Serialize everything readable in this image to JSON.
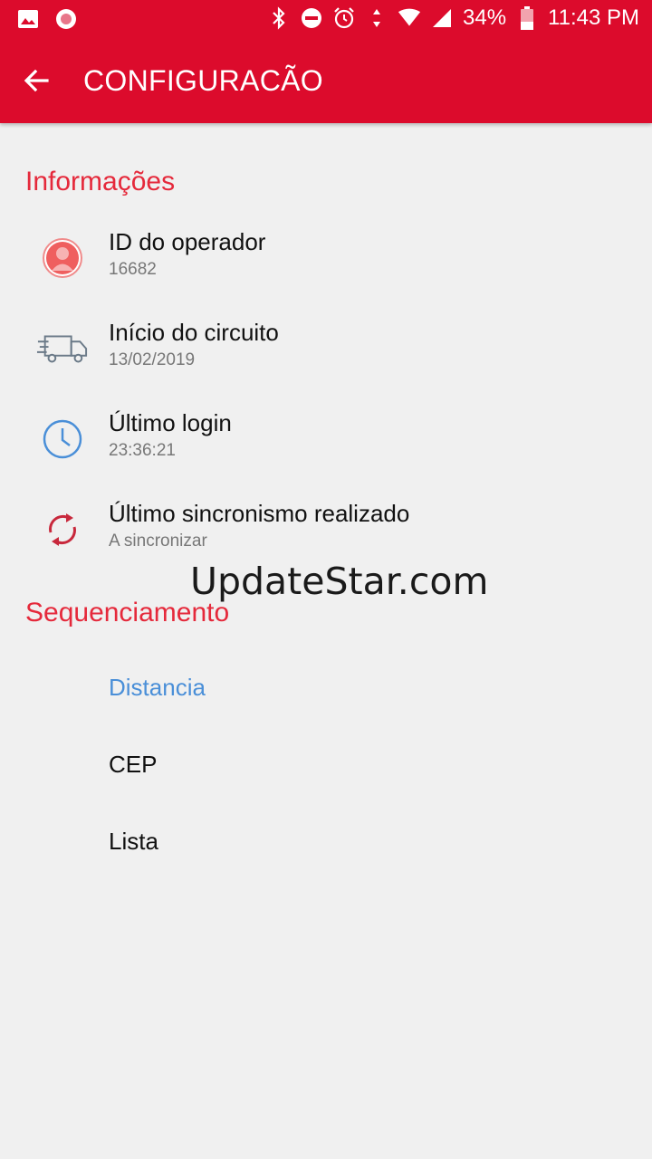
{
  "status_bar": {
    "battery": "34%",
    "time": "11:43 PM"
  },
  "app_bar": {
    "title": "CONFIGURACÃO"
  },
  "informacoes": {
    "title": "Informações",
    "items": [
      {
        "icon": "person-icon",
        "label": "ID do operador",
        "value": "16682"
      },
      {
        "icon": "delivery-truck-icon",
        "label": "Início do circuito",
        "value": "13/02/2019"
      },
      {
        "icon": "clock-icon",
        "label": "Último login",
        "value": "23:36:21"
      },
      {
        "icon": "sync-icon",
        "label": "Último sincronismo realizado",
        "value": "A sincronizar"
      }
    ]
  },
  "sequenciamento": {
    "title": "Sequenciamento",
    "options": [
      "Distancia",
      "CEP",
      "Lista"
    ],
    "selected": "Distancia"
  },
  "watermark": "UpdateStar.com",
  "colors": {
    "primary": "#dc0b2c",
    "section_title": "#e5293b",
    "selected_option": "#4a8fd8",
    "background": "#f0f0f0"
  }
}
